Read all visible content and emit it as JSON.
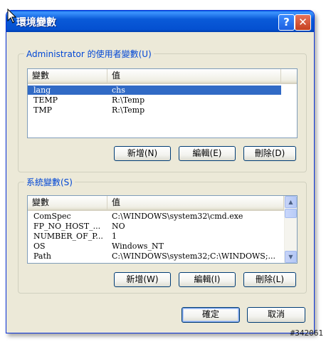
{
  "window": {
    "title": "環境變數",
    "help_label": "?",
    "close_label": "✕"
  },
  "user_group": {
    "legend": "Administrator 的使用者變數(U)",
    "columns": [
      "變數",
      "值"
    ],
    "rows": [
      {
        "name": "lang",
        "value": "chs",
        "selected": true
      },
      {
        "name": "TEMP",
        "value": "R:\\Temp",
        "selected": false
      },
      {
        "name": "TMP",
        "value": "R:\\Temp",
        "selected": false
      }
    ],
    "buttons": {
      "new": "新增(N)",
      "edit": "編輯(E)",
      "delete": "刪除(D)"
    }
  },
  "system_group": {
    "legend": "系統變數(S)",
    "columns": [
      "變數",
      "值"
    ],
    "rows": [
      {
        "name": "ComSpec",
        "value": "C:\\WINDOWS\\system32\\cmd.exe"
      },
      {
        "name": "FP_NO_HOST_...",
        "value": "NO"
      },
      {
        "name": "NUMBER_OF_P...",
        "value": "1"
      },
      {
        "name": "OS",
        "value": "Windows_NT"
      },
      {
        "name": "Path",
        "value": "C:\\WINDOWS\\system32;C:\\WINDOWS;..."
      }
    ],
    "buttons": {
      "new": "新增(W)",
      "edit": "編輯(I)",
      "delete": "刪除(L)"
    },
    "scroll_up": "▲",
    "scroll_down": "▼"
  },
  "dialog_buttons": {
    "ok": "確定",
    "cancel": "取消"
  },
  "watermark": "#342061"
}
